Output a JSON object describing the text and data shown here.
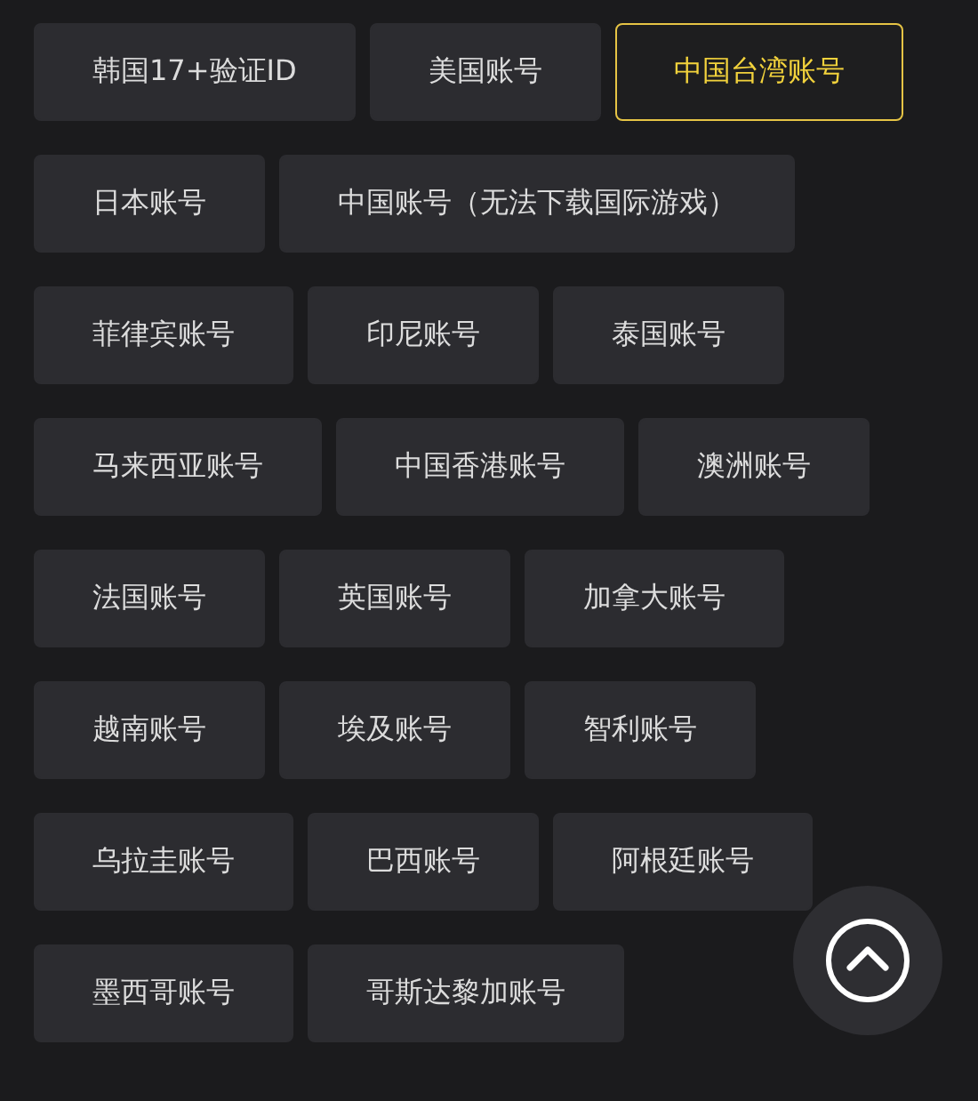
{
  "region_buttons": [
    {
      "label": "韩国17+验证ID",
      "selected": false
    },
    {
      "label": "美国账号",
      "selected": false
    },
    {
      "label": "中国台湾账号",
      "selected": true
    },
    {
      "label": "日本账号",
      "selected": false
    },
    {
      "label": "中国账号（无法下载国际游戏）",
      "selected": false
    },
    {
      "label": "菲律宾账号",
      "selected": false
    },
    {
      "label": "印尼账号",
      "selected": false
    },
    {
      "label": "泰国账号",
      "selected": false
    },
    {
      "label": "马来西亚账号",
      "selected": false
    },
    {
      "label": "中国香港账号",
      "selected": false
    },
    {
      "label": "澳洲账号",
      "selected": false
    },
    {
      "label": "法国账号",
      "selected": false
    },
    {
      "label": "英国账号",
      "selected": false
    },
    {
      "label": "加拿大账号",
      "selected": false
    },
    {
      "label": "越南账号",
      "selected": false
    },
    {
      "label": "埃及账号",
      "selected": false
    },
    {
      "label": "智利账号",
      "selected": false
    },
    {
      "label": "乌拉圭账号",
      "selected": false
    },
    {
      "label": "巴西账号",
      "selected": false
    },
    {
      "label": "阿根廷账号",
      "selected": false
    },
    {
      "label": "墨西哥账号",
      "selected": false
    },
    {
      "label": "哥斯达黎加账号",
      "selected": false
    }
  ]
}
